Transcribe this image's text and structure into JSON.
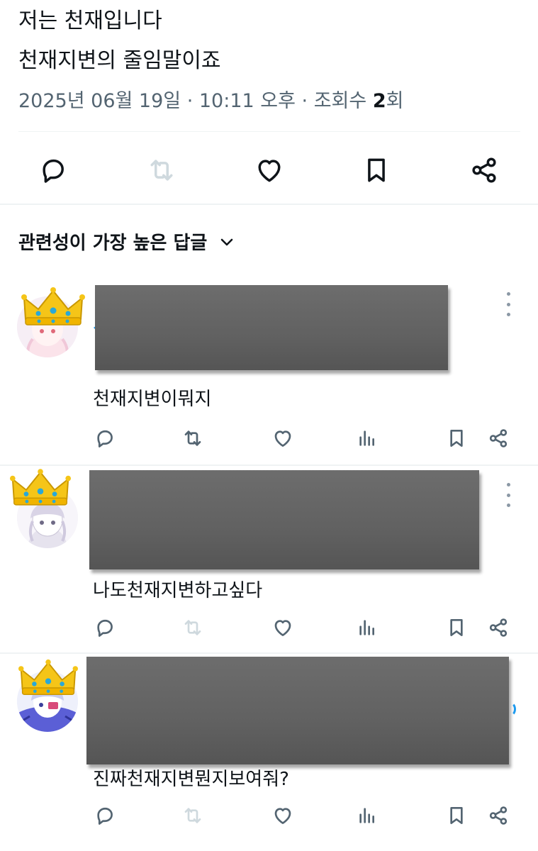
{
  "post": {
    "line1": "저는 천재입니다",
    "line2": "천재지변의 줄임말이죠",
    "date": "2025년 06월 19일",
    "time": "10:11 오후",
    "views_label": "조회수",
    "views_count": "2",
    "views_unit": "회",
    "separator": " · "
  },
  "actions": {
    "icons": [
      "reply-icon",
      "retweet-icon",
      "like-icon",
      "bookmark-icon",
      "share-icon"
    ]
  },
  "replies_header": {
    "label": "관련성이 가장 높은 답글",
    "chevron_icon": "chevron-down-icon"
  },
  "replies": [
    {
      "text": "천재지변이뭐지",
      "author_redacted": true
    },
    {
      "text": "나도천재지변하고싶다",
      "author_redacted": true
    },
    {
      "text": "진짜천재지변뭔지보여줘?",
      "author_redacted": true
    }
  ],
  "reply_action_icons": [
    "reply-icon",
    "retweet-icon",
    "like-icon",
    "views-icon",
    "bookmark-icon",
    "share-icon"
  ],
  "colors": {
    "text": "#0f1419",
    "muted": "#536471",
    "icon": "#536471",
    "retweet_disabled": "#cfd9de",
    "divider": "#eff3f4",
    "redaction": "#636363",
    "crown_gold": "#f5c518",
    "accent": "#1d9bf0"
  }
}
